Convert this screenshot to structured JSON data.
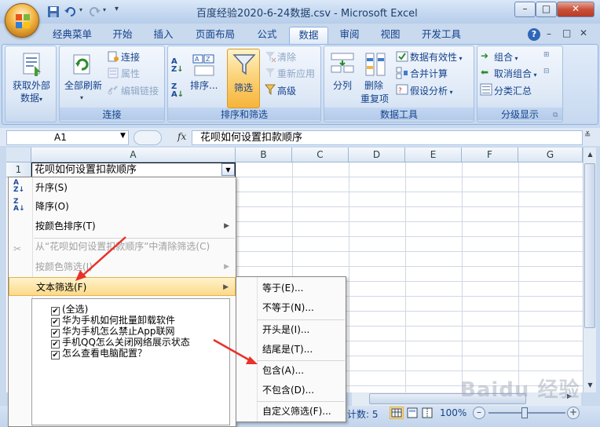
{
  "window": {
    "title": "百度经验2020-6-24数据.csv - Microsoft Excel",
    "controls": [
      "–",
      "□",
      "✕"
    ],
    "ribbon_controls": [
      "?",
      "–",
      "□",
      "✕"
    ]
  },
  "tabs": [
    "经典菜单",
    "开始",
    "插入",
    "页面布局",
    "公式",
    "数据",
    "审阅",
    "视图",
    "开发工具"
  ],
  "active_tab": "数据",
  "ribbon": {
    "get_external": "获取外部数据",
    "connections": {
      "refresh_all": "全部刷新",
      "connections": "连接",
      "properties": "属性",
      "edit_links": "编辑链接",
      "title": "连接"
    },
    "sort_filter": {
      "sort": "排序...",
      "filter": "筛选",
      "clear": "清除",
      "reapply": "重新应用",
      "advanced": "高级",
      "title": "排序和筛选"
    },
    "data_tools": {
      "text_to_columns": "分列",
      "remove_dup_1": "删除",
      "remove_dup_2": "重复项",
      "validation": "数据有效性",
      "consolidate": "合并计算",
      "what_if": "假设分析",
      "title": "数据工具"
    },
    "outline": {
      "group": "组合",
      "ungroup": "取消组合",
      "subtotal": "分类汇总",
      "title": "分级显示"
    }
  },
  "formula_bar": {
    "name_box": "A1",
    "fx": "fx",
    "value": "花呗如何设置扣款顺序"
  },
  "columns": [
    "A",
    "B",
    "C",
    "D",
    "E",
    "F",
    "G"
  ],
  "rows": [
    "1"
  ],
  "cell_a1": "花呗如何设置扣款顺序",
  "filter_menu": {
    "sort_asc": "升序(S)",
    "sort_desc": "降序(O)",
    "sort_color": "按颜色排序(T)",
    "clear_filter": "从“花呗如何设置扣款顺序”中清除筛选(C)",
    "filter_color": "按颜色筛选(I)",
    "text_filter": "文本筛选(F)",
    "checklist": [
      "(全选)",
      "华为手机如何批量卸载软件",
      "华为手机怎么禁止App联网",
      "手机QQ怎么关闭网络展示状态",
      "怎么查看电脑配置？"
    ]
  },
  "submenu": [
    "等于(E)...",
    "不等于(N)...",
    "开头是(I)...",
    "结尾是(T)...",
    "包含(A)...",
    "不包含(D)...",
    "自定义筛选(F)..."
  ],
  "status": {
    "count": "计数: 5",
    "zoom": "100%"
  },
  "watermark": "Baidu 经验",
  "colors": {
    "ribbon": "#dfe9f5",
    "highlight": "#fcd988",
    "arrow": "#e8322a"
  }
}
